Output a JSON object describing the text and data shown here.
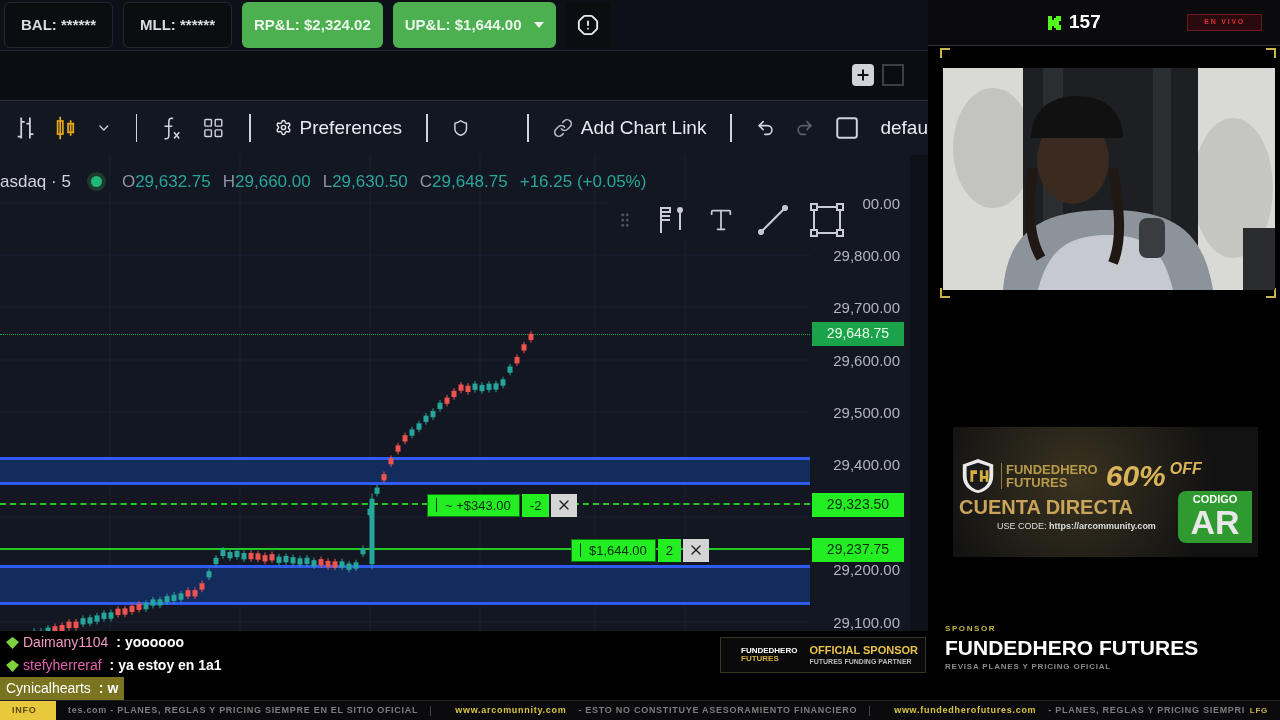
{
  "account_bar": {
    "items": [
      {
        "kind": "masked",
        "label": "BAL: ******"
      },
      {
        "kind": "masked",
        "label": "MLL: ******"
      },
      {
        "kind": "pnl",
        "label": "RP&L: $2,324.02"
      },
      {
        "kind": "pnl_dropdown",
        "label": "UP&L: $1,644.00"
      }
    ]
  },
  "toolbar": {
    "preferences": "Preferences",
    "add_chart_link": "Add Chart Link",
    "layout": "defau"
  },
  "chart": {
    "symbol": "asdaq · 5",
    "ohlc": [
      {
        "label": "O",
        "value": "29,632.75"
      },
      {
        "label": "H",
        "value": "29,660.00"
      },
      {
        "label": "L",
        "value": "29,630.50"
      },
      {
        "label": "C",
        "value": "29,648.75"
      }
    ],
    "change": "+16.25 (+0.05%)",
    "price_axis": [
      "00.00",
      "29,800.00",
      "29,700.00",
      "29,600.00",
      "29,500.00",
      "29,400.00",
      "29,200.00",
      "29,100.00"
    ],
    "price_tags": [
      {
        "kind": "last",
        "price": "29,648.75"
      },
      {
        "kind": "order",
        "price": "29,323.50"
      },
      {
        "kind": "position",
        "price": "29,237.75"
      }
    ],
    "orders": [
      {
        "kind": "order",
        "pnl": "~ +$343.00",
        "qty": "-2"
      },
      {
        "kind": "position",
        "pnl": "$1,644.00",
        "qty": "2"
      }
    ]
  },
  "chat": [
    {
      "user": "Daimany1104",
      "message": ": yoooooo",
      "color": "#f29ac4",
      "highlighted": false
    },
    {
      "user": "stefyherreraf",
      "message": ": ya estoy en 1a1",
      "color": "#e062b0",
      "highlighted": false
    },
    {
      "user": "Cynicalhearts",
      "message": ": w",
      "highlighted": true
    }
  ],
  "stream": {
    "viewers": "157",
    "live_badge": "EN VIVO"
  },
  "ad": {
    "brand_top": "FUNDEDHERO",
    "brand_bottom": "FUTURES",
    "discount": "60%",
    "off": "OFF",
    "headline": "CUENTA DIRECTA",
    "code_prefix": "USE CODE:",
    "code_url": "https://arcommunity.com",
    "code_label": "CODIGO",
    "code": "AR"
  },
  "official_sponsor": {
    "logo_top": "FUNDEDHERO",
    "logo_bottom": "FUTURES",
    "title": "OFFICIAL SPONSOR",
    "subtitle": "FUTURES FUNDING PARTNER"
  },
  "sponsor": {
    "label": "SPONSOR",
    "name": "FUNDEDHERO FUTURES",
    "tagline": "REVISA PLANES Y PRICING OFICIAL"
  },
  "ticker": {
    "label": "INFO",
    "items": [
      {
        "kind": "text",
        "text": "tes.com  -  PLANES, REGLAS Y PRICING SIEMPRE EN EL SITIO OFICIAL"
      },
      {
        "kind": "divider"
      },
      {
        "kind": "url",
        "text": "www.arcomunnity.com"
      },
      {
        "kind": "text",
        "text": "-  ESTO NO CONSTITUYE ASESORAMIENTO FINANCIERO"
      },
      {
        "kind": "divider"
      },
      {
        "kind": "url",
        "text": "www.fundedherofutures.com"
      },
      {
        "kind": "text",
        "text": "-  PLANES, REGLAS Y PRICING SIEMPRI"
      }
    ],
    "end": "LFG"
  }
}
